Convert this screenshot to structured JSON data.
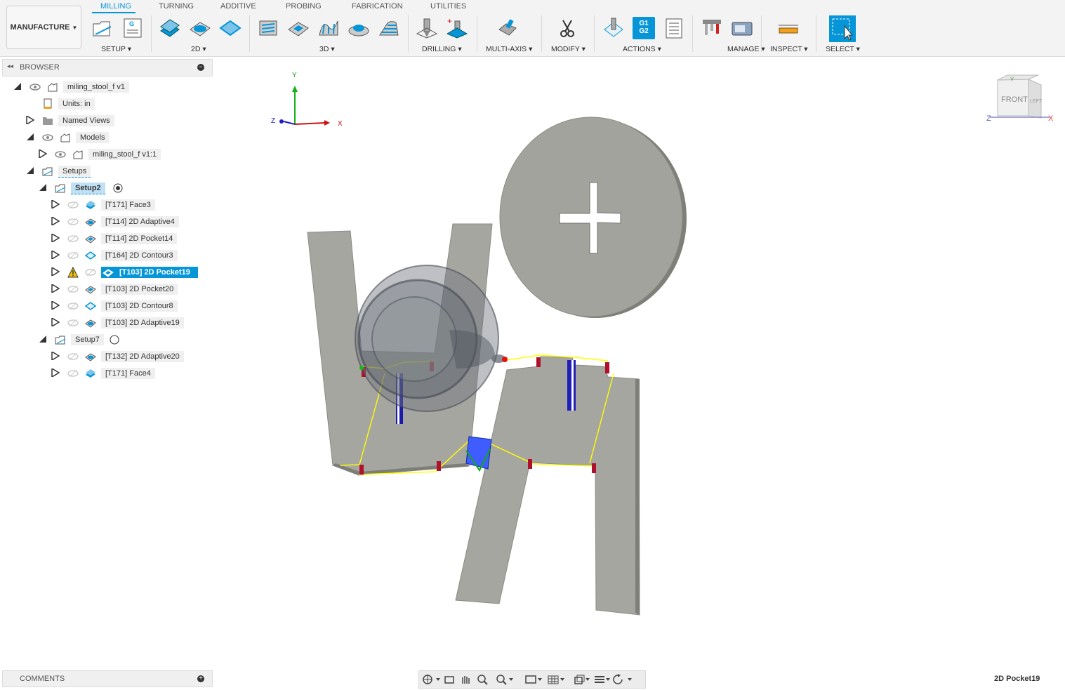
{
  "workspace": {
    "label": "MANUFACTURE"
  },
  "tabs": [
    {
      "label": "MILLING"
    },
    {
      "label": "TURNING"
    },
    {
      "label": "ADDITIVE"
    },
    {
      "label": "PROBING"
    },
    {
      "label": "FABRICATION"
    },
    {
      "label": "UTILITIES"
    }
  ],
  "groups": [
    {
      "label": "SETUP"
    },
    {
      "label": "2D"
    },
    {
      "label": "3D"
    },
    {
      "label": "DRILLING"
    },
    {
      "label": "MULTI-AXIS"
    },
    {
      "label": "MODIFY"
    },
    {
      "label": "ACTIONS"
    },
    {
      "label": "MANAGE"
    },
    {
      "label": "INSPECT"
    },
    {
      "label": "SELECT"
    }
  ],
  "browser": {
    "title": "BROWSER",
    "nodes": [
      {
        "label": "miling_stool_f v1"
      },
      {
        "label": "Units: in"
      },
      {
        "label": "Named Views"
      },
      {
        "label": "Models"
      },
      {
        "label": "miling_stool_f v1:1"
      },
      {
        "label": "Setups"
      },
      {
        "label": "Setup2"
      },
      {
        "label": "[T171] Face3"
      },
      {
        "label": "[T114] 2D Adaptive4"
      },
      {
        "label": "[T114] 2D Pocket14"
      },
      {
        "label": "[T164] 2D Contour3"
      },
      {
        "label": "[T103] 2D Pocket19"
      },
      {
        "label": "[T103] 2D Pocket20"
      },
      {
        "label": "[T103] 2D Contour8"
      },
      {
        "label": "[T103] 2D Adaptive19"
      },
      {
        "label": "Setup7"
      },
      {
        "label": "[T132] 2D Adaptive20"
      },
      {
        "label": "[T171] Face4"
      }
    ]
  },
  "comments": {
    "title": "COMMENTS"
  },
  "triad": {
    "x": "X",
    "y": "Y",
    "z": "Z"
  },
  "viewcube": {
    "face": "FRONT",
    "side": "LEFT",
    "x": "X",
    "y": "Y",
    "z": "Z"
  },
  "status": {
    "operation": "2D Pocket19"
  },
  "actions": {
    "g1": "G1",
    "g2": "G2"
  },
  "colors": {
    "accent": "#0696d7",
    "part": "#a3a39e",
    "toolpath": "#ffff00",
    "warning": "#f2c200"
  }
}
